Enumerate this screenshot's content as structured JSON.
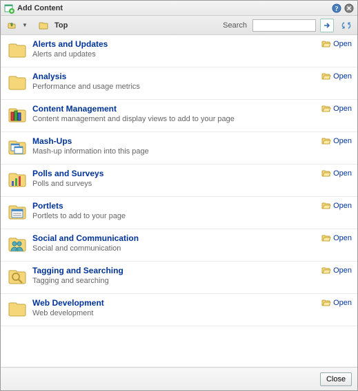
{
  "window": {
    "title": "Add Content"
  },
  "toolbar": {
    "top_label": "Top",
    "search_label": "Search",
    "search_placeholder": ""
  },
  "items": [
    {
      "title": "Alerts and Updates",
      "desc": "Alerts and updates",
      "icon": "folder",
      "action": "Open"
    },
    {
      "title": "Analysis",
      "desc": "Performance and usage metrics",
      "icon": "folder",
      "action": "Open"
    },
    {
      "title": "Content Management",
      "desc": "Content management and display views to add to your page",
      "icon": "books",
      "action": "Open"
    },
    {
      "title": "Mash-Ups",
      "desc": "Mash-up information into this page",
      "icon": "windows",
      "action": "Open"
    },
    {
      "title": "Polls and Surveys",
      "desc": "Polls and surveys",
      "icon": "chart",
      "action": "Open"
    },
    {
      "title": "Portlets",
      "desc": "Portlets to add to your page",
      "icon": "portlet",
      "action": "Open"
    },
    {
      "title": "Social and Communication",
      "desc": "Social and communication",
      "icon": "people",
      "action": "Open"
    },
    {
      "title": "Tagging and Searching",
      "desc": "Tagging and searching",
      "icon": "search",
      "action": "Open"
    },
    {
      "title": "Web Development",
      "desc": "Web development",
      "icon": "folder",
      "action": "Open"
    }
  ],
  "footer": {
    "close": "Close"
  }
}
